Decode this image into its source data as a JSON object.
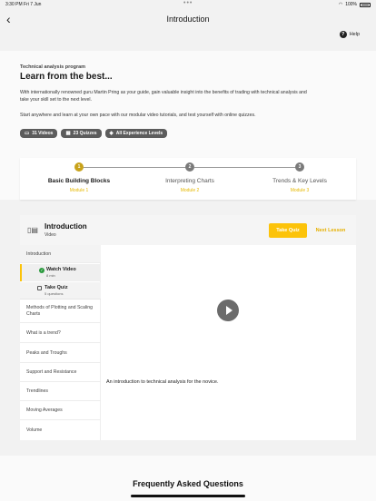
{
  "status": {
    "time": "3:30 PM  Fri 7 Jun",
    "dots": "•••",
    "battery": "100%"
  },
  "nav": {
    "back_glyph": "‹",
    "title": "Introduction",
    "help_label": "Help",
    "help_glyph": "?"
  },
  "hero": {
    "eyebrow": "Technical analysis program",
    "headline": "Learn from the best...",
    "desc1": "With internationally renowned guru Martin Pring as your guide, gain valuable insight into the benefits of trading with technical analysis and take your skill set to the next level.",
    "desc2": "Start anywhere and learn at your own pace with our modular video tutorials, and test yourself with online quizzes.",
    "pills": [
      {
        "icon": "▭",
        "label": "31 Videos"
      },
      {
        "icon": "▦",
        "label": "23 Quizzes"
      },
      {
        "icon": "◈",
        "label": "All Experience Levels"
      }
    ]
  },
  "modules": [
    {
      "num": "1",
      "title": "Basic Building Blocks",
      "sub": "Module 1"
    },
    {
      "num": "2",
      "title": "Interpreting Charts",
      "sub": "Module 2"
    },
    {
      "num": "3",
      "title": "Trends & Key Levels",
      "sub": "Module 3"
    }
  ],
  "course": {
    "icon": "▯▤",
    "title": "Introduction",
    "subtitle": "Video",
    "take_quiz": "Take Quiz",
    "next_lesson": "Next Lesson",
    "caption": "An introduction to technical analysis for the novice."
  },
  "sidebar": {
    "section": "Introduction",
    "sub": [
      {
        "label": "Watch Video",
        "meta": "8 min",
        "check": "✓"
      },
      {
        "label": "Take Quiz",
        "meta": "5 questions"
      }
    ],
    "items": [
      "Methods of Plotting and Scaling Charts",
      "What is a trend?",
      "Peaks and Troughs",
      "Support and Resistance",
      "Trendlines",
      "Moving Averages",
      "Volume"
    ]
  },
  "faq": {
    "title": "Frequently Asked Questions"
  },
  "colors": {
    "accent": "#fcc30a",
    "success": "#2b9a3e",
    "pill": "#5c5c5c"
  }
}
